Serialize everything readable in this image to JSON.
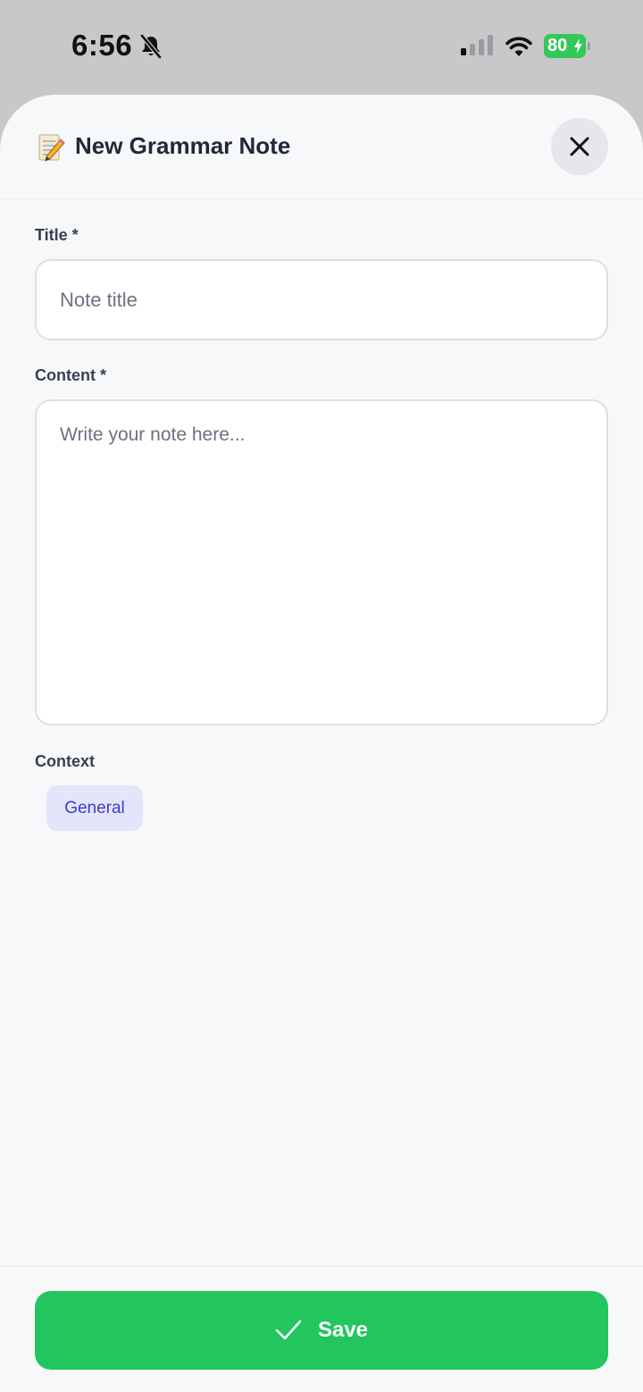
{
  "status_bar": {
    "time": "6:56",
    "battery_level": "80",
    "icons": [
      "bell-slash-icon",
      "cellular-signal-icon",
      "wifi-icon",
      "battery-charging-icon"
    ]
  },
  "header": {
    "emoji": "memo-icon",
    "title": "New Grammar Note",
    "close_icon": "close-icon"
  },
  "form": {
    "title_label": "Title *",
    "title_placeholder": "Note title",
    "title_value": "",
    "content_label": "Content *",
    "content_placeholder": "Write your note here...",
    "content_value": "",
    "context_label": "Context",
    "context_options": [
      "General"
    ],
    "context_selected": "General"
  },
  "footer": {
    "save_label": "Save",
    "save_icon": "checkmark-icon"
  },
  "colors": {
    "accent_green": "#22c55e",
    "chip_bg": "#e3e6fb",
    "chip_text": "#4338ca",
    "battery_green": "#34c759"
  }
}
